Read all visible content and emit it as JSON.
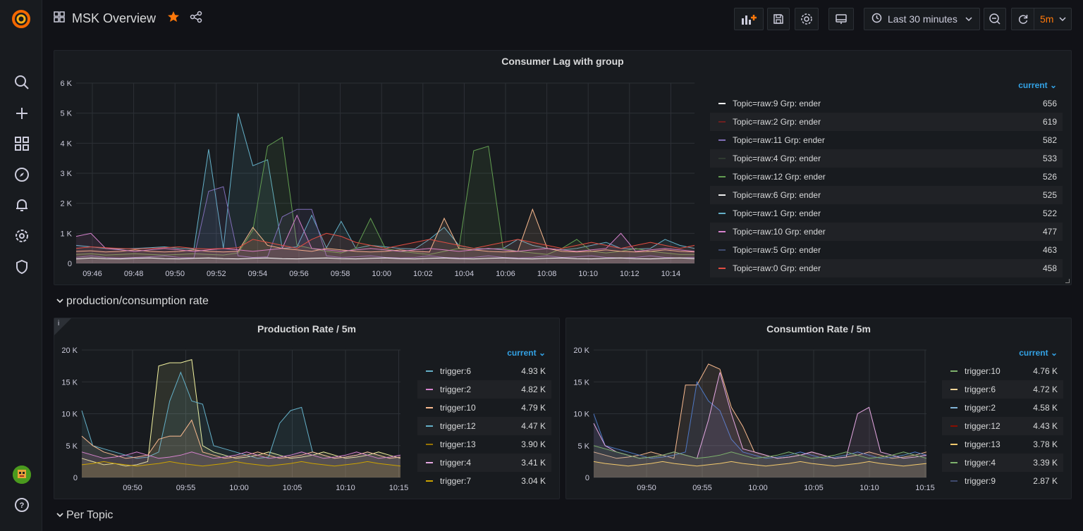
{
  "app": {
    "title": "MSK Overview",
    "accent": "#ff780a",
    "link_color": "#33a2e5"
  },
  "toolbar": {
    "time_range": "Last 30 minutes",
    "refresh_interval": "5m"
  },
  "sidebar": {
    "icons": [
      "search-icon",
      "plus-icon",
      "dashboards-icon",
      "explore-icon",
      "alerting-icon",
      "configuration-icon",
      "shield-icon",
      "help-icon"
    ]
  },
  "panels": {
    "consumer_lag": {
      "title": "Consumer Lag with group",
      "legend_header": "current",
      "legend": [
        {
          "name": "Topic=raw:9 Grp: ender",
          "value": "656",
          "color": "#ffffff"
        },
        {
          "name": "Topic=raw:2 Grp: ender",
          "value": "619",
          "color": "#6e1f1f"
        },
        {
          "name": "Topic=raw:11 Grp: ender",
          "value": "582",
          "color": "#806eb7"
        },
        {
          "name": "Topic=raw:4 Grp: ender",
          "value": "533",
          "color": "#2f3a30"
        },
        {
          "name": "Topic=raw:12 Grp: ender",
          "value": "526",
          "color": "#629e51"
        },
        {
          "name": "Topic=raw:6 Grp: ender",
          "value": "525",
          "color": "#eeeeee"
        },
        {
          "name": "Topic=raw:1 Grp: ender",
          "value": "522",
          "color": "#64b0c8"
        },
        {
          "name": "Topic=raw:10 Grp: ender",
          "value": "477",
          "color": "#d683ce"
        },
        {
          "name": "Topic=raw:5 Grp: ender",
          "value": "463",
          "color": "#3f4a6e"
        },
        {
          "name": "Topic=raw:0 Grp: ender",
          "value": "458",
          "color": "#e24d42"
        }
      ]
    },
    "production": {
      "title": "Production Rate / 5m",
      "legend_header": "current",
      "legend": [
        {
          "name": "trigger:6",
          "value": "4.93 K",
          "color": "#64b0c8"
        },
        {
          "name": "trigger:2",
          "value": "4.82 K",
          "color": "#d683ce"
        },
        {
          "name": "trigger:10",
          "value": "4.79 K",
          "color": "#f9ba8f"
        },
        {
          "name": "trigger:12",
          "value": "4.47 K",
          "color": "#64b0c8"
        },
        {
          "name": "trigger:13",
          "value": "3.90 K",
          "color": "#967302"
        },
        {
          "name": "trigger:4",
          "value": "3.41 K",
          "color": "#e5a8e2"
        },
        {
          "name": "trigger:7",
          "value": "3.04 K",
          "color": "#cca300"
        }
      ]
    },
    "consumption": {
      "title": "Consumtion Rate / 5m",
      "legend_header": "current",
      "legend": [
        {
          "name": "trigger:10",
          "value": "4.76 K",
          "color": "#7eb26d"
        },
        {
          "name": "trigger:6",
          "value": "4.72 K",
          "color": "#f4d598"
        },
        {
          "name": "trigger:2",
          "value": "4.58 K",
          "color": "#82b5d8"
        },
        {
          "name": "trigger:12",
          "value": "4.43 K",
          "color": "#890f02"
        },
        {
          "name": "trigger:13",
          "value": "3.78 K",
          "color": "#f2c96d"
        },
        {
          "name": "trigger:4",
          "value": "3.39 K",
          "color": "#7eb26d"
        },
        {
          "name": "trigger:9",
          "value": "2.87 K",
          "color": "#3f4a6e"
        }
      ]
    }
  },
  "rows": {
    "production_consumption": "production/consumption rate",
    "per_topic": "Per Topic"
  },
  "chart_data": [
    {
      "type": "line",
      "title": "Consumer Lag with group",
      "ylim": [
        0,
        6000
      ],
      "yticks": [
        "0",
        "1 K",
        "2 K",
        "3 K",
        "4 K",
        "5 K",
        "6 K"
      ],
      "xticks": [
        "09:46",
        "09:48",
        "09:50",
        "09:52",
        "09:54",
        "09:56",
        "09:58",
        "10:00",
        "10:02",
        "10:04",
        "10:06",
        "10:08",
        "10:10",
        "10:12",
        "10:14"
      ],
      "series": [
        {
          "color": "#64b0c8",
          "values": [
            600,
            550,
            500,
            480,
            500,
            520,
            550,
            500,
            480,
            3800,
            500,
            5000,
            3250,
            3450,
            500,
            550,
            1600,
            520,
            1400,
            500,
            600,
            550,
            500,
            480,
            800,
            1200,
            600,
            500,
            480,
            500,
            800,
            600,
            500,
            450,
            500,
            600,
            700,
            500,
            480,
            500,
            800,
            600,
            500
          ]
        },
        {
          "color": "#629e51",
          "values": [
            300,
            320,
            280,
            300,
            320,
            300,
            280,
            300,
            320,
            300,
            280,
            350,
            1100,
            3900,
            4200,
            600,
            500,
            400,
            350,
            500,
            1500,
            500,
            400,
            350,
            300,
            400,
            500,
            3750,
            3900,
            500,
            400,
            350,
            300,
            500,
            800,
            400,
            350,
            400,
            500,
            400,
            350,
            300,
            300
          ]
        },
        {
          "color": "#806eb7",
          "values": [
            200,
            250,
            200,
            180,
            200,
            220,
            250,
            200,
            180,
            2400,
            2550,
            250,
            200,
            220,
            1550,
            1800,
            1800,
            250,
            200,
            220,
            250,
            200,
            180,
            200,
            250,
            200,
            180,
            200,
            250,
            200,
            180,
            200,
            250,
            200,
            220,
            250,
            200,
            180,
            200,
            250,
            200,
            180,
            200
          ]
        },
        {
          "color": "#f9ba8f",
          "values": [
            400,
            420,
            380,
            400,
            450,
            400,
            380,
            400,
            450,
            400,
            380,
            400,
            1200,
            600,
            500,
            450,
            400,
            500,
            450,
            400,
            380,
            400,
            450,
            400,
            380,
            1500,
            500,
            450,
            400,
            380,
            400,
            1800,
            500,
            400,
            380,
            400,
            450,
            400,
            380,
            400,
            450,
            400,
            380
          ]
        },
        {
          "color": "#d683ce",
          "values": [
            900,
            1000,
            500,
            450,
            400,
            450,
            500,
            450,
            400,
            450,
            500,
            450,
            400,
            450,
            500,
            1600,
            500,
            450,
            400,
            450,
            500,
            450,
            400,
            450,
            500,
            450,
            400,
            450,
            500,
            450,
            400,
            450,
            500,
            450,
            400,
            450,
            500,
            1000,
            400,
            450,
            500,
            450,
            400
          ]
        },
        {
          "color": "#e24d42",
          "values": [
            500,
            550,
            520,
            500,
            480,
            500,
            520,
            550,
            500,
            480,
            500,
            520,
            800,
            700,
            600,
            500,
            800,
            1000,
            900,
            700,
            600,
            500,
            600,
            700,
            800,
            700,
            600,
            500,
            600,
            700,
            800,
            700,
            600,
            500,
            600,
            700,
            600,
            500,
            600,
            700,
            600,
            500,
            600
          ]
        },
        {
          "color": "#ffffff",
          "values": [
            150,
            180,
            160,
            150,
            170,
            180,
            160,
            150,
            170,
            180,
            160,
            150,
            170,
            180,
            160,
            150,
            170,
            180,
            160,
            150,
            170,
            180,
            160,
            150,
            170,
            180,
            160,
            150,
            170,
            180,
            160,
            150,
            170,
            180,
            160,
            150,
            170,
            180,
            160,
            150,
            170,
            180,
            160
          ]
        }
      ]
    },
    {
      "type": "line",
      "title": "Production Rate / 5m",
      "ylim": [
        0,
        20000
      ],
      "yticks": [
        "0",
        "5 K",
        "10 K",
        "15 K",
        "20 K"
      ],
      "xticks": [
        "09:50",
        "09:55",
        "10:00",
        "10:05",
        "10:10",
        "10:15"
      ],
      "series": [
        {
          "color": "#f4f4a0",
          "values": [
            3000,
            2500,
            2000,
            2200,
            1800,
            2000,
            2500,
            17500,
            18000,
            18000,
            18500,
            5000,
            4000,
            3500,
            3000,
            3200,
            3500,
            4000,
            3500,
            3000,
            3200,
            3500,
            4000,
            3500,
            3000,
            3200,
            3500,
            4000,
            3500,
            3000
          ]
        },
        {
          "color": "#64b0c8",
          "values": [
            10500,
            5000,
            4500,
            4000,
            3500,
            3000,
            3200,
            4000,
            12000,
            16500,
            12000,
            11500,
            5000,
            4500,
            4000,
            3500,
            3000,
            3200,
            8500,
            10500,
            11000,
            4000,
            3500,
            3000,
            3200,
            3500,
            4000,
            3500,
            3000,
            3200
          ]
        },
        {
          "color": "#f9ba8f",
          "values": [
            6500,
            5000,
            4000,
            3500,
            3000,
            3200,
            3500,
            6000,
            6500,
            6500,
            9000,
            4000,
            3500,
            3000,
            3200,
            3500,
            4000,
            3500,
            3000,
            3200,
            3500,
            4000,
            3500,
            3000,
            3200,
            3500,
            4000,
            3500,
            3000,
            3200
          ]
        },
        {
          "color": "#d683ce",
          "values": [
            4000,
            3500,
            3000,
            3200,
            3500,
            4000,
            3500,
            3000,
            3200,
            3500,
            4000,
            3500,
            3000,
            3200,
            3500,
            4000,
            3500,
            3000,
            3200,
            3500,
            4000,
            3500,
            3000,
            3200,
            3500,
            4000,
            3500,
            3000,
            3200,
            3500
          ]
        },
        {
          "color": "#cca300",
          "values": [
            2000,
            2200,
            2500,
            2200,
            2000,
            1800,
            2000,
            2200,
            2500,
            2200,
            2000,
            1800,
            2000,
            2200,
            2500,
            2200,
            2000,
            1800,
            2000,
            2200,
            2500,
            2200,
            2000,
            1800,
            2000,
            2200,
            2500,
            2200,
            2000,
            1800
          ]
        }
      ]
    },
    {
      "type": "line",
      "title": "Consumtion Rate / 5m",
      "ylim": [
        0,
        20000
      ],
      "yticks": [
        "0",
        "5 K",
        "10 K",
        "15 K",
        "20 K"
      ],
      "xticks": [
        "09:50",
        "09:55",
        "10:00",
        "10:05",
        "10:10",
        "10:15"
      ],
      "series": [
        {
          "color": "#f9ba8f",
          "values": [
            4000,
            3500,
            3000,
            3200,
            3500,
            4000,
            3500,
            3000,
            14500,
            14500,
            17800,
            17000,
            11000,
            8000,
            4000,
            3500,
            3000,
            3200,
            3500,
            4000,
            3500,
            3000,
            3200,
            3500,
            4000,
            3500,
            3000,
            3200,
            3500,
            4000
          ]
        },
        {
          "color": "#4e78c4",
          "values": [
            10000,
            5000,
            4500,
            4000,
            3500,
            3000,
            3200,
            3500,
            4000,
            15000,
            12000,
            10500,
            6000,
            4000,
            3500,
            3000,
            3200,
            3500,
            4000,
            3500,
            3000,
            3200,
            3500,
            4000,
            3500,
            3000,
            3200,
            3500,
            4000,
            3500
          ]
        },
        {
          "color": "#e5a8e2",
          "values": [
            8500,
            5000,
            4000,
            3500,
            3000,
            3200,
            3500,
            4000,
            3500,
            3000,
            9000,
            16500,
            10000,
            4500,
            4000,
            3500,
            3000,
            3200,
            3500,
            4000,
            3500,
            3000,
            3200,
            10000,
            11000,
            4000,
            3500,
            3000,
            3200,
            3500
          ]
        },
        {
          "color": "#7eb26d",
          "values": [
            5000,
            4500,
            4000,
            3500,
            3000,
            3200,
            3500,
            4000,
            3500,
            3000,
            3200,
            3500,
            4000,
            3500,
            3000,
            3200,
            3500,
            4000,
            3500,
            3000,
            3200,
            3500,
            4000,
            3500,
            3000,
            3200,
            3500,
            4000,
            3500,
            3000
          ]
        },
        {
          "color": "#f2c96d",
          "values": [
            2500,
            2200,
            2000,
            1800,
            2000,
            2200,
            2500,
            2200,
            2000,
            1800,
            2000,
            2200,
            2500,
            2200,
            2000,
            1800,
            2000,
            2200,
            2500,
            2200,
            2000,
            1800,
            2000,
            2200,
            2500,
            2200,
            2000,
            1800,
            2000,
            2200
          ]
        }
      ]
    }
  ]
}
